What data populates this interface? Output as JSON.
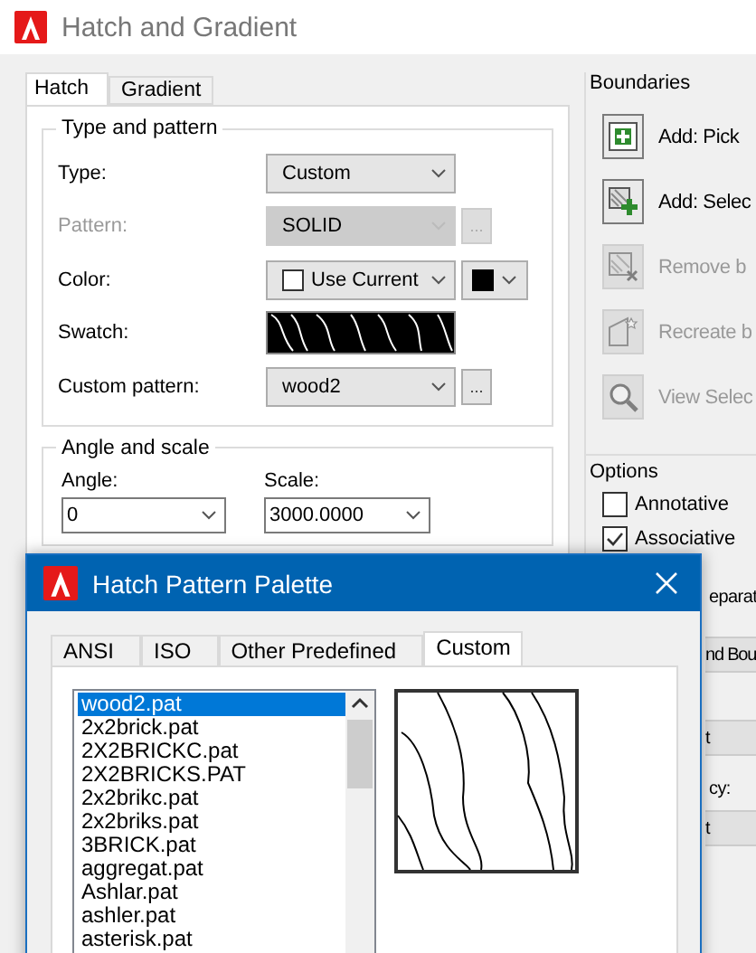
{
  "window": {
    "title": "Hatch and Gradient"
  },
  "tabs": [
    {
      "label": "Hatch",
      "selected": true
    },
    {
      "label": "Gradient",
      "selected": false
    }
  ],
  "type_and_pattern": {
    "title": "Type and pattern",
    "fields": [
      {
        "label": "Type:",
        "kind": "dropdown",
        "value": "Custom",
        "disabled": false
      },
      {
        "label": "Pattern:",
        "kind": "dropdown",
        "value": "SOLID",
        "disabled": true,
        "browse": "..."
      },
      {
        "label": "Color:",
        "kind": "color",
        "value": "Use Current",
        "disabled": false
      },
      {
        "label": "Swatch:",
        "kind": "swatch",
        "disabled": false
      },
      {
        "label": "Custom pattern:",
        "kind": "dropdown",
        "value": "wood2",
        "disabled": false,
        "browse": "..."
      }
    ]
  },
  "angle_and_scale": {
    "title": "Angle and scale",
    "fields": [
      {
        "label": "Angle:",
        "value": "0"
      },
      {
        "label": "Scale:",
        "value": "3000.0000"
      }
    ]
  },
  "boundaries": {
    "title": "Boundaries",
    "buttons": [
      {
        "label": "Add: Pick",
        "kind": "pick",
        "disabled": false
      },
      {
        "label": "Add: Selec",
        "kind": "select",
        "disabled": false
      },
      {
        "label": "Remove b",
        "kind": "remove",
        "disabled": true
      },
      {
        "label": "Recreate b",
        "kind": "recreate",
        "disabled": true
      },
      {
        "label": "View Selec",
        "kind": "view",
        "disabled": true
      }
    ]
  },
  "options": {
    "title": "Options",
    "checkboxes": [
      {
        "label": "Annotative",
        "checked": false
      },
      {
        "label": "Associative",
        "checked": true
      }
    ]
  },
  "covered_fragments": [
    {
      "text": "eparat",
      "kind": "text"
    },
    {
      "text": "nd Bou",
      "kind": "button"
    },
    {
      "text": "t",
      "kind": "dropdown"
    },
    {
      "text": "cy:",
      "kind": "text"
    },
    {
      "text": "t",
      "kind": "dropdown"
    }
  ],
  "palette": {
    "title": "Hatch Pattern Palette",
    "tabs": [
      {
        "label": "ANSI",
        "selected": false
      },
      {
        "label": "ISO",
        "selected": false
      },
      {
        "label": "Other Predefined",
        "selected": false
      },
      {
        "label": "Custom",
        "selected": true
      }
    ],
    "patterns": [
      {
        "name": "wood2.pat",
        "selected": true
      },
      {
        "name": "2x2brick.pat",
        "selected": false
      },
      {
        "name": "2X2BRICKC.pat",
        "selected": false
      },
      {
        "name": "2X2BRICKS.PAT",
        "selected": false
      },
      {
        "name": "2x2brikc.pat",
        "selected": false
      },
      {
        "name": "2x2briks.pat",
        "selected": false
      },
      {
        "name": "3BRICK.pat",
        "selected": false
      },
      {
        "name": "aggregat.pat",
        "selected": false
      },
      {
        "name": "Ashlar.pat",
        "selected": false
      },
      {
        "name": "ashler.pat",
        "selected": false
      },
      {
        "name": "asterisk.pat",
        "selected": false
      }
    ]
  }
}
